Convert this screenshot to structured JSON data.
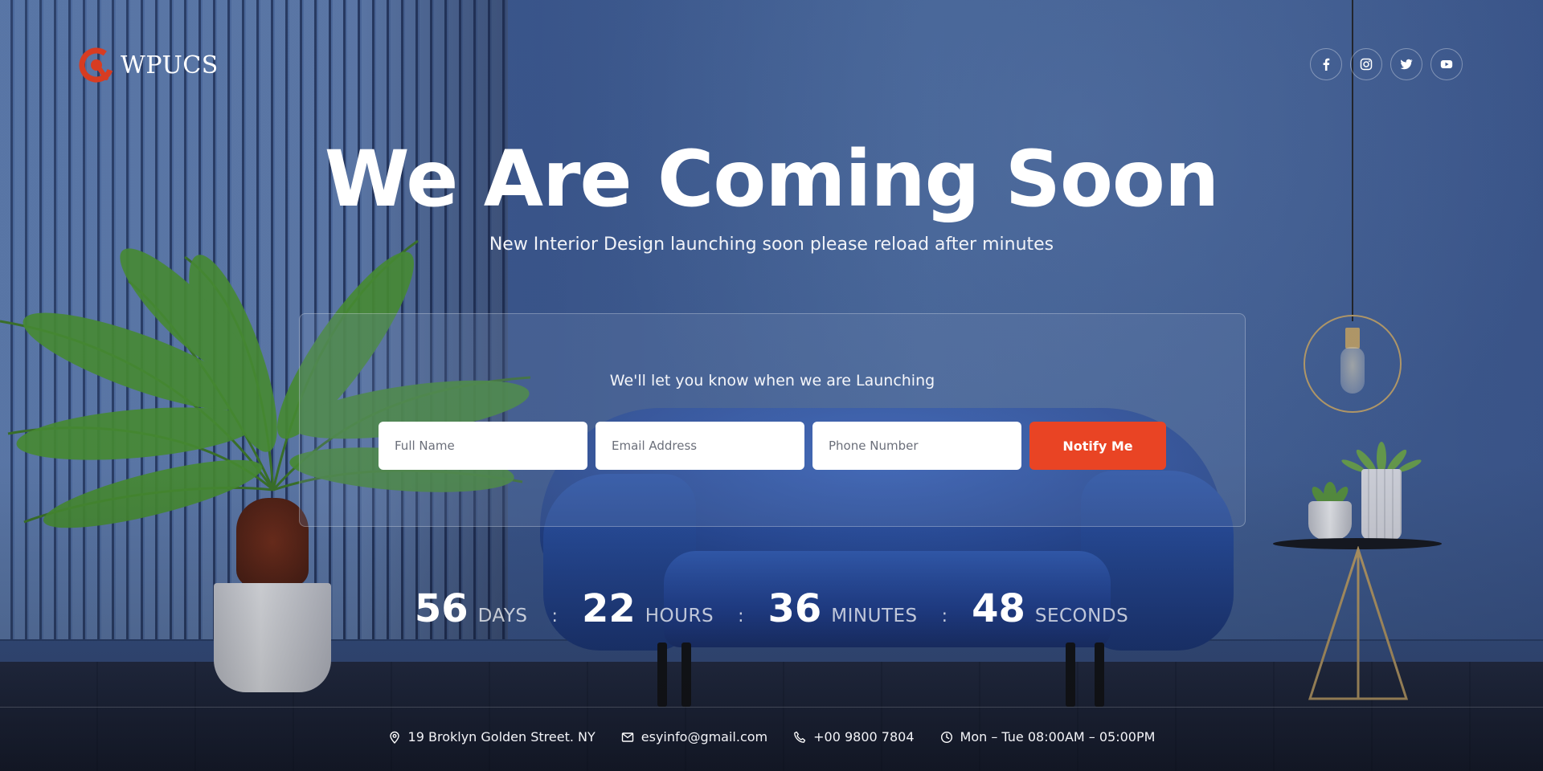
{
  "brand": {
    "name": "WPUCS",
    "accent": "#e94424"
  },
  "social": [
    {
      "name": "facebook",
      "icon": "facebook-icon"
    },
    {
      "name": "instagram",
      "icon": "instagram-icon"
    },
    {
      "name": "twitter",
      "icon": "twitter-icon"
    },
    {
      "name": "youtube",
      "icon": "youtube-icon"
    }
  ],
  "hero": {
    "title": "We Are Coming Soon",
    "subtitle": "New Interior Design launching soon please reload after minutes"
  },
  "form": {
    "label": "We'll let you know when we are Launching",
    "full_name_placeholder": "Full Name",
    "email_placeholder": "Email Address",
    "phone_placeholder": "Phone Number",
    "submit_label": "Notify Me"
  },
  "countdown": {
    "days": "56",
    "days_label": "DAYS",
    "hours": "22",
    "hours_label": "HOURS",
    "minutes": "36",
    "minutes_label": "MINUTES",
    "seconds": "48",
    "seconds_label": "SECONDS",
    "separator": ":"
  },
  "footer": {
    "address": "19 Broklyn Golden Street. NY",
    "email": "esyinfo@gmail.com",
    "phone": "+00 9800 7804",
    "hours": "Mon – Tue 08:00AM – 05:00PM"
  }
}
